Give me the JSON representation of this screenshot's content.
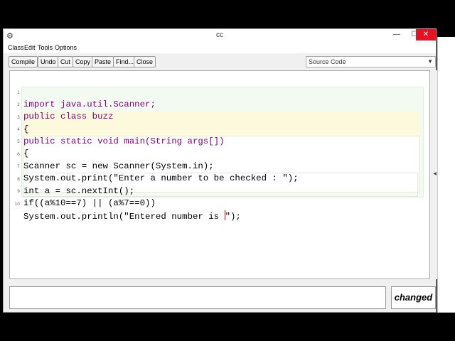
{
  "window": {
    "title": "cc",
    "min_glyph": "—",
    "max_glyph": "☐",
    "close_glyph": "✕"
  },
  "menu": {
    "items": [
      "Class",
      "Edit",
      "Tools",
      "Options"
    ]
  },
  "toolbar": {
    "buttons": [
      "Compile",
      "Undo",
      "Cut",
      "Copy",
      "Paste",
      "Find...",
      "Close"
    ],
    "view_select": "Source Code"
  },
  "editor": {
    "lines": [
      {
        "num": "1",
        "text": "import java.util.Scanner;"
      },
      {
        "num": "2",
        "text": "public class buzz"
      },
      {
        "num": "3",
        "text": "{"
      },
      {
        "num": "4",
        "text": "public static void main(String args[])"
      },
      {
        "num": "5",
        "text": "{"
      },
      {
        "num": "6",
        "text": "Scanner sc = new Scanner(System.in);"
      },
      {
        "num": "7",
        "text": "System.out.print(\"Enter a number to be checked : \");"
      },
      {
        "num": "8",
        "text": "int a = sc.nextInt();"
      },
      {
        "num": "9",
        "text": "if((a%10==7) || (a%7==0))"
      },
      {
        "num": "10",
        "text_before_cursor": "System.out.println(\"Entered number is ",
        "text_after_cursor": "\");"
      }
    ]
  },
  "status": {
    "changed_label": "changed"
  },
  "colors": {
    "keyword": "#800080",
    "class_block": "#f2faf2",
    "method_block": "#fcf9dc",
    "close_button": "#e81123"
  },
  "icons": {
    "app": "bluej-icon",
    "dropdown": "chevron-down-icon"
  }
}
